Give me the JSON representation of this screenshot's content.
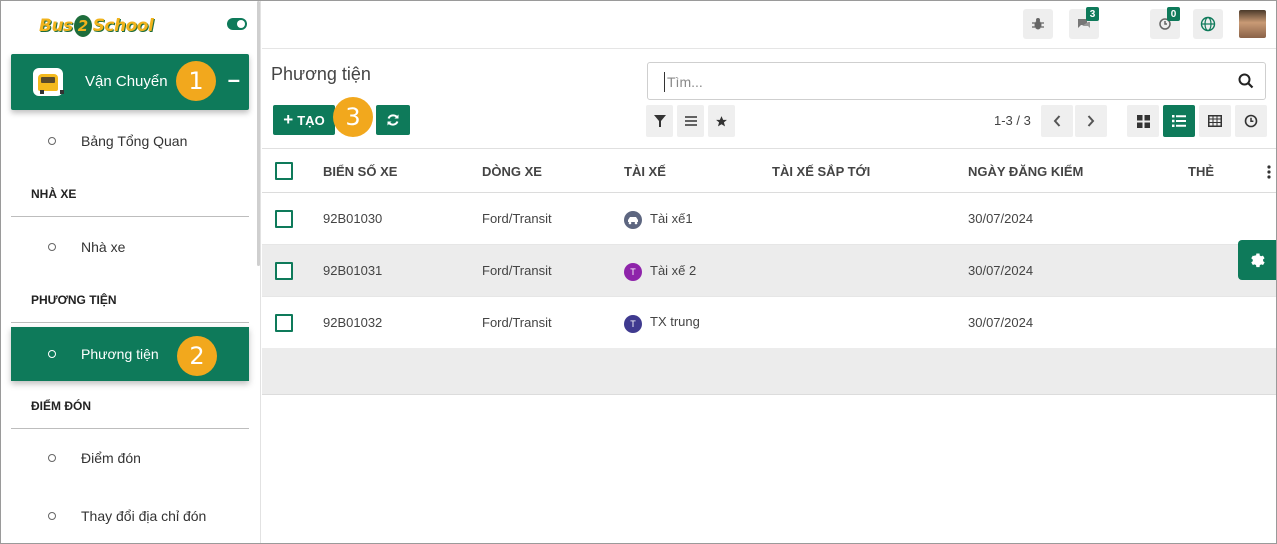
{
  "app": {
    "logo_text_1": "Bus",
    "logo_text_2": "2",
    "logo_text_3": "School"
  },
  "sidebar": {
    "main_menu": "Vận Chuyển",
    "collapse_symbol": "–",
    "items": {
      "dashboard": "Bảng Tổng Quan",
      "section_garage": "NHÀ XE",
      "garage": "Nhà xe",
      "section_vehicle": "PHƯƠNG TIỆN",
      "vehicle": "Phương tiện",
      "section_pickup": "ĐIỂM ĐÓN",
      "pickup": "Điểm đón",
      "change_pickup": "Thay đổi địa chỉ đón"
    }
  },
  "callouts": {
    "one": "1",
    "two": "2",
    "three": "3"
  },
  "topbar": {
    "messages_count": "3",
    "activity_count": "0"
  },
  "control": {
    "breadcrumb": "Phương tiện",
    "search_placeholder": "Tìm...",
    "create_label": "TẠO",
    "pager": "1-3 / 3"
  },
  "table": {
    "headers": {
      "plate": "BIỂN SỐ XE",
      "model": "DÒNG XE",
      "driver": "TÀI XẾ",
      "next_driver": "TÀI XẾ SẮP TỚI",
      "inspection": "NGÀY ĐĂNG KIỂM",
      "tags": "THẺ"
    },
    "rows": [
      {
        "plate": "92B01030",
        "model": "Ford/Transit",
        "driver": "Tài xế1",
        "driver_initial": "",
        "inspection": "30/07/2024"
      },
      {
        "plate": "92B01031",
        "model": "Ford/Transit",
        "driver": "Tài xế 2",
        "driver_initial": "T",
        "inspection": "30/07/2024"
      },
      {
        "plate": "92B01032",
        "model": "Ford/Transit",
        "driver": "TX trung",
        "driver_initial": "T",
        "inspection": "30/07/2024"
      }
    ]
  },
  "colors": {
    "accent": "#0e7a5a",
    "callout": "#f2a81d",
    "driver2_avatar": "#8e24aa",
    "driver3_avatar": "#3f3a8f"
  }
}
